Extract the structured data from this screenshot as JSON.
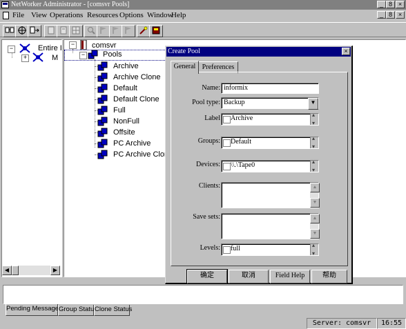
{
  "window": {
    "title": "NetWorker Administrator - [comsvr Pools]",
    "controls": [
      "_",
      "8",
      "×"
    ],
    "mdi_controls": [
      "_",
      "8",
      "×"
    ]
  },
  "menubar": {
    "items": [
      {
        "label": "File"
      },
      {
        "label": "View"
      },
      {
        "label": "Operations"
      },
      {
        "label": "Resources"
      },
      {
        "label": "Options"
      },
      {
        "label": "Window"
      },
      {
        "label": "Help"
      }
    ]
  },
  "toolbar": {
    "icons": [
      "connect-icon",
      "target-icon",
      "export-icon",
      "doc-icon",
      "doc2-icon",
      "grid-icon",
      "zoom-icon",
      "flag-icon",
      "flag2-icon",
      "flag3-icon",
      "wand-icon",
      "book-icon"
    ]
  },
  "left_tree": {
    "root_label": "Entire I",
    "child_label": "M"
  },
  "right_tree": {
    "server": "comsvr",
    "pools_label": "Pools",
    "pools": [
      "Archive",
      "Archive Clone",
      "Default",
      "Default Clone",
      "Full",
      "NonFull",
      "Offsite",
      "PC Archive",
      "PC Archive Clone"
    ]
  },
  "dialog": {
    "title": "Create Pool",
    "tabs": [
      {
        "label": "General"
      },
      {
        "label": "Preferences"
      }
    ],
    "fields": {
      "name_label": "Name:",
      "name_value": "informix",
      "pool_type_label": "Pool type:",
      "pool_type_value": "Backup",
      "label_label": "Label",
      "label_value": "Archive",
      "groups_label": "Groups:",
      "groups_value": "Default",
      "devices_label": "Devices:",
      "devices_value": "\\\\.\\Tape0",
      "clients_label": "Clients:",
      "save_sets_label": "Save sets:",
      "levels_label": "Levels:",
      "levels_value": "full"
    },
    "buttons": {
      "ok": "确定",
      "cancel": "取消",
      "field_help": "Field Help",
      "help": "帮助"
    }
  },
  "bottom_tabs": [
    {
      "label": "Pending Messages"
    },
    {
      "label": "Group Status"
    },
    {
      "label": "Clone Status"
    }
  ],
  "statusbar": {
    "server": "Server: comsvr",
    "time": "16:55"
  },
  "colors": {
    "title_active": "#000080",
    "title_inactive": "#808080",
    "face": "#c0c0c0"
  }
}
